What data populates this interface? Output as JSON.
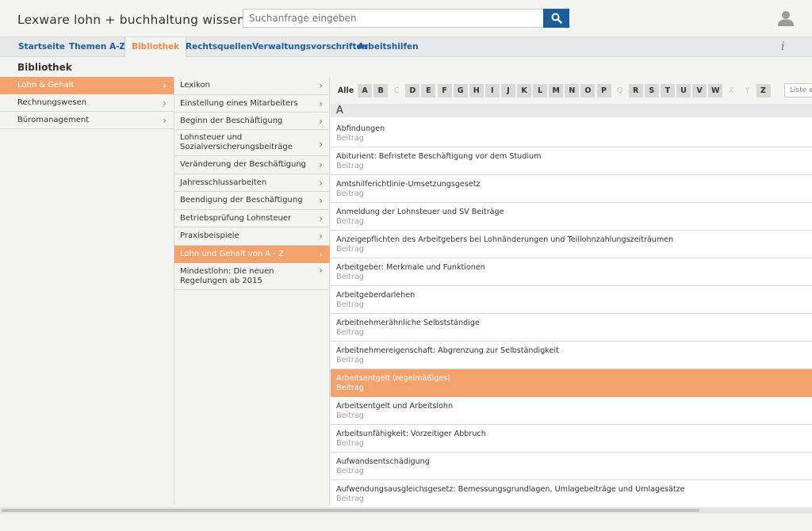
{
  "header": {
    "title": "Lexware lohn + buchhaltung wissen",
    "search_placeholder": "Suchanfrage eingeben",
    "icons": [
      "search-icon",
      "user-icon",
      "info-icon"
    ]
  },
  "nav": {
    "items": [
      "Startseite",
      "Themen A-Z",
      "Bibliothek",
      "Rechtsquellen",
      "Verwaltungsvorschriften",
      "Arbeitshilfen"
    ],
    "active": "Bibliothek",
    "info": "i"
  },
  "page_title": "Bibliothek",
  "categories": [
    {
      "label": "Lohn & Gehalt",
      "selected": true
    },
    {
      "label": "Rechnungswesen",
      "selected": false
    },
    {
      "label": "Büromanagement",
      "selected": false
    }
  ],
  "subcategories": [
    {
      "label": "Lexikon"
    },
    {
      "label": "Einstellung eines Mitarbeiters"
    },
    {
      "label": "Beginn der Beschäftigung"
    },
    {
      "label": "Lohnsteuer und Sozialversicherungsbeiträge"
    },
    {
      "label": "Veränderung der Beschäftigung"
    },
    {
      "label": "Jahresschlussarbeiten"
    },
    {
      "label": "Beendigung der Beschäftigung"
    },
    {
      "label": "Betriebsprüfung Lohnsteuer"
    },
    {
      "label": "Praxisbeispiele"
    },
    {
      "label": "Lohn und Gehalt von A - Z",
      "selected": true
    },
    {
      "label": "Mindestlohn: Die neuen Regelungen ab 2015"
    }
  ],
  "alphabet": {
    "all_label": "Alle",
    "letters": [
      "A",
      "B",
      "C",
      "D",
      "E",
      "F",
      "G",
      "H",
      "I",
      "J",
      "K",
      "L",
      "M",
      "N",
      "O",
      "P",
      "Q",
      "R",
      "S",
      "T",
      "U",
      "V",
      "W",
      "X",
      "Y",
      "Z"
    ],
    "disabled": [
      "C",
      "Q",
      "X",
      "Y"
    ],
    "filter_placeholder": "Liste ei"
  },
  "section_letter": "A",
  "entries": [
    {
      "title": "Abfindungen",
      "type": "Beitrag"
    },
    {
      "title": "Abiturient: Befristete Beschäftigung vor dem Studium",
      "type": "Beitrag"
    },
    {
      "title": "Amtshilferichtlinie-Umsetzungsgesetz",
      "type": "Beitrag"
    },
    {
      "title": "Anmeldung der Lohnsteuer und SV Beiträge",
      "type": "Beitrag"
    },
    {
      "title": "Anzeigepflichten des Arbeitgebers bei Lohnänderungen und Teillohnzahlungszeiträumen",
      "type": "Beitrag"
    },
    {
      "title": "Arbeitgeber: Merkmale und Funktionen",
      "type": "Beitrag"
    },
    {
      "title": "Arbeitgeberdarlehen",
      "type": "Beitrag"
    },
    {
      "title": "Arbeitnehmerähnliche Selbstständige",
      "type": "Beitrag"
    },
    {
      "title": "Arbeitnehmereigenschaft: Abgrenzung zur Selbständigkeit",
      "type": "Beitrag"
    },
    {
      "title": "Arbeitsentgelt (regelmäßiges)",
      "type": "Beitrag",
      "selected": true
    },
    {
      "title": "Arbeitsentgelt und Arbeitslohn",
      "type": "Beitrag"
    },
    {
      "title": "Arbeitsunfähigkeit: Vorzeitiger Abbruch",
      "type": "Beitrag"
    },
    {
      "title": "Aufwandsentschädigung",
      "type": "Beitrag"
    },
    {
      "title": "Aufwendungsausgleichsgesetz: Bemessungsgrundlagen, Umlagebeiträge und Umlagesätze",
      "type": "Beitrag"
    }
  ],
  "colors": {
    "accent": "#f4a26b",
    "link": "#1d5d9b",
    "active_tab": "#ef8a4a"
  }
}
